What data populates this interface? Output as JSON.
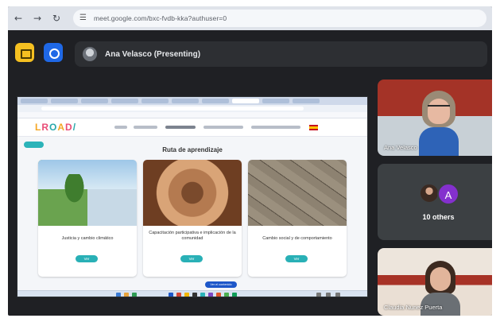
{
  "browser": {
    "url": "meet.google.com/bxc-fvdb-kka?authuser=0",
    "icons": [
      "back-arrow-icon",
      "forward-arrow-icon",
      "reload-icon",
      "tune-icon"
    ]
  },
  "meet": {
    "presenter_label": "Ana Velasco (Presenting)",
    "participants": [
      {
        "name": "Ana Velasco"
      },
      {
        "others_label": "10 others",
        "avatar_letter": "A"
      },
      {
        "name": "Claudia Nunez Puerta"
      }
    ]
  },
  "shared_screen": {
    "site_logo": [
      "L",
      "R",
      "O",
      "A",
      "D",
      "/"
    ],
    "back_button": "Atrás",
    "page_title": "Ruta de aprendizaje",
    "cards": [
      {
        "caption": "Justicia y cambio climático",
        "button": "Ver"
      },
      {
        "caption": "Capacitación participativa e implicación de la comunidad",
        "button": "Ver"
      },
      {
        "caption": "Cambio social y de comportamiento",
        "button": "Ver"
      }
    ],
    "floating_pill": "Ver el contenido"
  },
  "colors": {
    "meet_bg": "#1f2024",
    "accent_teal": "#29b0b6",
    "avatar_purple": "#8430ce"
  }
}
